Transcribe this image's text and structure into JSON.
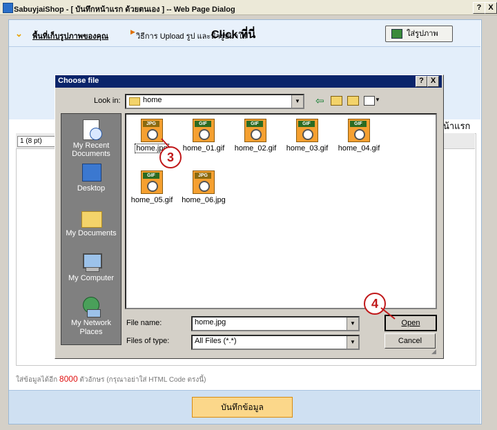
{
  "window": {
    "title": "SabuyjaiShop - [ บันทึกหน้าแรก ด้วยตนเอง ] -- Web Page Dialog",
    "help": "?",
    "close": "X"
  },
  "topbar": {
    "link_text": "พื้นที่เก็บรูปภาพของคุณ",
    "info_text": "วิธีการ Upload รูป และนำรูปมาใส่",
    "click_text": "Click ที่นี่",
    "insert_image_button": "ใส่รูปภาพ"
  },
  "editor": {
    "font_size_value": "1 (8 pt)",
    "partial_label": "น้าแรก",
    "remaining_prefix": "ใส่ข้อมูลได้อีก",
    "remaining_count": "8000",
    "remaining_suffix": "ตัวอักษร (กรุณาอย่าใส่ HTML Code ตรงนี้)"
  },
  "save_button": "บันทึกข้อมูล",
  "dialog": {
    "title": "Choose file",
    "help": "?",
    "close": "X",
    "look_in_label": "Look in:",
    "look_in_value": "home",
    "places": [
      {
        "label": "My Recent Documents",
        "icon": "recent-documents-icon"
      },
      {
        "label": "Desktop",
        "icon": "desktop-icon"
      },
      {
        "label": "My Documents",
        "icon": "my-documents-icon"
      },
      {
        "label": "My Computer",
        "icon": "my-computer-icon"
      },
      {
        "label": "My Network Places",
        "icon": "network-places-icon"
      }
    ],
    "files": [
      {
        "name": "home.jpg",
        "type": "JPG"
      },
      {
        "name": "home_01.gif",
        "type": "GIF"
      },
      {
        "name": "home_02.gif",
        "type": "GIF"
      },
      {
        "name": "home_03.gif",
        "type": "GIF"
      },
      {
        "name": "home_04.gif",
        "type": "GIF"
      },
      {
        "name": "home_05.gif",
        "type": "GIF"
      },
      {
        "name": "home_06.jpg",
        "type": "JPG"
      }
    ],
    "file_name_label": "File name:",
    "file_name_value": "home.jpg",
    "files_of_type_label": "Files of type:",
    "files_of_type_value": "All Files (*.*)",
    "open_button": "Open",
    "cancel_button": "Cancel"
  },
  "callouts": {
    "step3": "3",
    "step4": "4"
  },
  "colors": {
    "accent_red": "#c0181a",
    "title_blue": "#0a246a",
    "save_orange": "#fbd78a"
  }
}
